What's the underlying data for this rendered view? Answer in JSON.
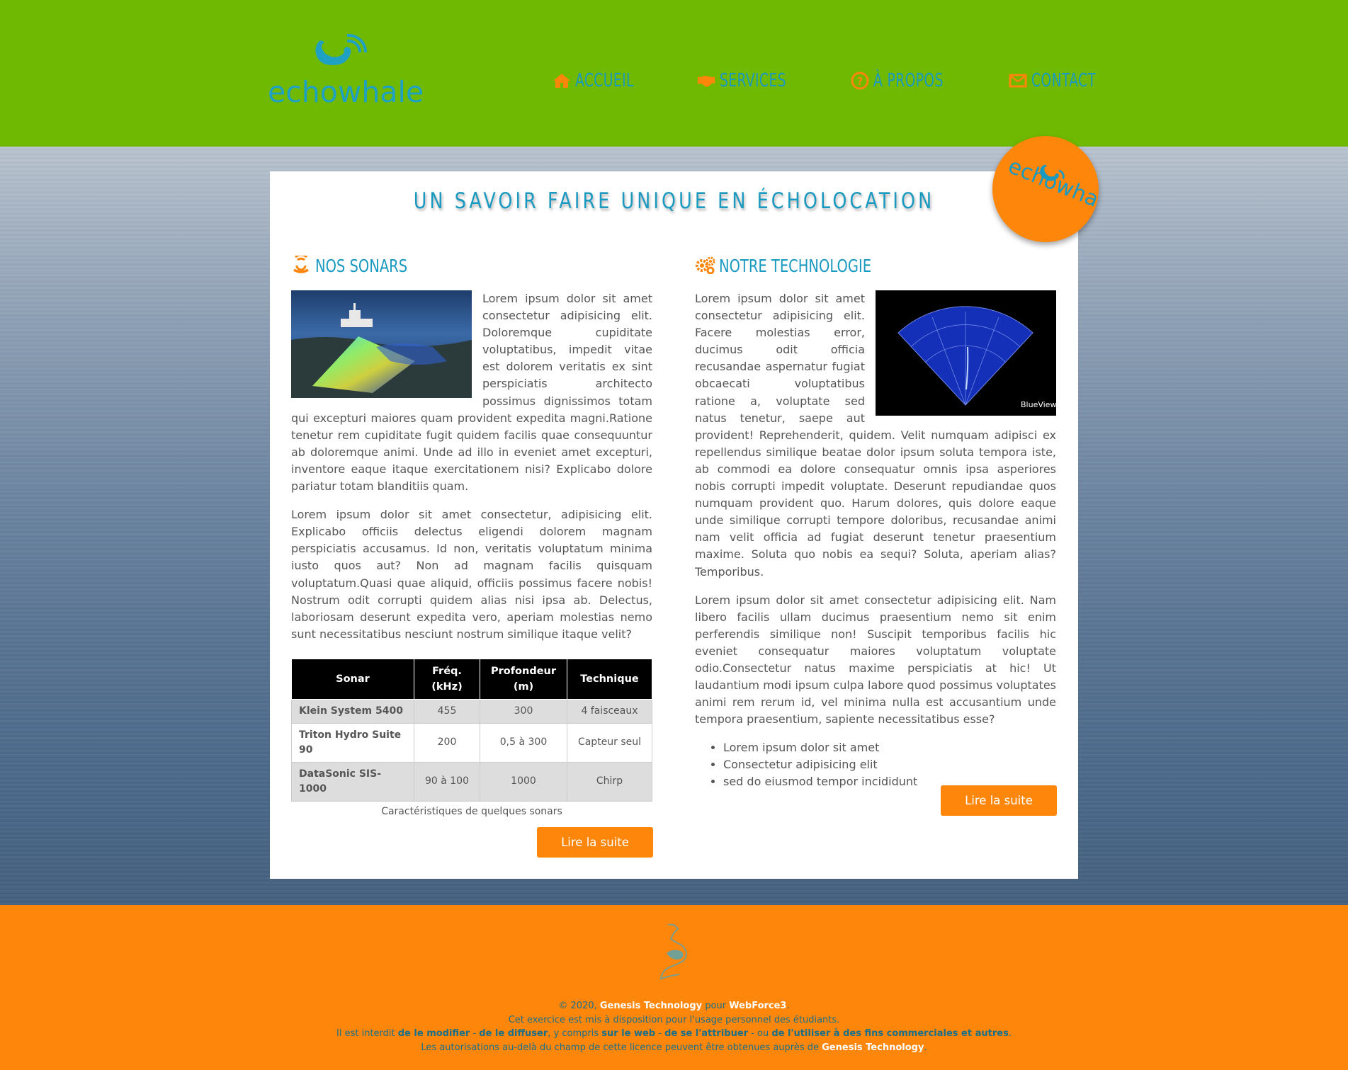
{
  "brand": {
    "logo_text_1": "echo",
    "logo_text_2": "whale",
    "badge_text": "echowhale"
  },
  "nav": [
    {
      "label": "ACCUEIL",
      "icon": "home-icon"
    },
    {
      "label": "SERVICES",
      "icon": "handshake-icon"
    },
    {
      "label": "À PROPOS",
      "icon": "question-circle-icon"
    },
    {
      "label": "CONTACT",
      "icon": "envelope-icon"
    }
  ],
  "colors": {
    "green": "#6fb902",
    "orange": "#fd860b",
    "blue": "#1a9ac0"
  },
  "main": {
    "title": "UN SAVOIR FAIRE UNIQUE EN ÉCHOLOCATION"
  },
  "left": {
    "title": "NOS SONARS",
    "p1": "Lorem ipsum dolor sit amet consectetur adipisicing elit. Doloremque cupiditate voluptatibus, impedit vitae est dolorem veritatis ex sint perspiciatis architecto possimus dignissimos totam qui excepturi maiores quam provident expedita magni.Ratione tenetur rem cupiditate fugit quidem facilis quae consequuntur ab doloremque animi. Unde ad illo in eveniet amet excepturi, inventore eaque itaque exercitationem nisi? Explicabo dolore pariatur totam blanditiis quam.",
    "p2": "Lorem ipsum dolor sit amet consectetur, adipisicing elit. Explicabo officiis delectus eligendi dolorem magnam perspiciatis accusamus. Id non, veritatis voluptatum minima iusto quos aut? Non ad magnam facilis quisquam voluptatum.Quasi quae aliquid, officiis possimus facere nobis! Nostrum odit corrupti quidem alias nisi ipsa ab. Delectus, laboriosam deserunt expedita vero, aperiam molestias nemo sunt necessitatibus nesciunt nostrum similique itaque velit?",
    "table": {
      "headers": [
        "Sonar",
        "Fréq. (kHz)",
        "Profondeur (m)",
        "Technique"
      ],
      "rows": [
        [
          "Klein System 5400",
          "455",
          "300",
          "4 faisceaux"
        ],
        [
          "Triton Hydro Suite 90",
          "200",
          "0,5 à 300",
          "Capteur seul"
        ],
        [
          "DataSonic SIS-1000",
          "90 à 100",
          "1000",
          "Chirp"
        ]
      ],
      "caption": "Caractéristiques de quelques sonars"
    },
    "button": "Lire la suite"
  },
  "right": {
    "title": "NOTRE TECHNOLOGIE",
    "p1": "Lorem ipsum dolor sit amet consectetur adipisicing elit. Facere molestias error, ducimus odit officia recusandae aspernatur fugiat obcaecati voluptatibus ratione a, voluptate sed natus tenetur, saepe aut provident! Reprehenderit, quidem. Velit numquam adipisci ex repellendus similique beatae dolor ipsum soluta tempora iste, ab commodi ea dolore consequatur omnis ipsa asperiores nobis corrupti impedit voluptate. Deserunt repudiandae quos numquam provident quo. Harum dolores, quis dolore eaque unde similique corrupti tempore doloribus, recusandae animi nam velit officia ad fugiat deserunt tenetur praesentium maxime. Soluta quo nobis ea sequi? Soluta, aperiam alias? Temporibus.",
    "p2": "Lorem ipsum dolor sit amet consectetur adipisicing elit. Nam libero facilis ullam ducimus praesentium nemo sit enim perferendis similique non! Suscipit temporibus facilis hic eveniet consequatur maiores voluptatum voluptate odio.Consectetur natus maxime perspiciatis at hic! Ut laudantium modi ipsum culpa labore quod possimus voluptates animi rem rerum id, vel minima nulla est accusantium unde tempora praesentium, sapiente necessitatibus esse?",
    "list": [
      "Lorem ipsum dolor sit amet",
      "Consectetur adipisicing elit",
      "sed do eiusmod tempor incididunt"
    ],
    "button": "Lire la suite",
    "image_label": "BlueView"
  },
  "footer": {
    "line1_a": "© 2020, ",
    "line1_b": "Genesis Technology",
    "line1_c": " pour ",
    "line1_d": "WebForce3",
    "line1_e": ".",
    "line2": "Cet exercice est mis à disposition pour l'usage personnel des étudiants.",
    "line3_a": "Il est interdit ",
    "line3_b": "de le modifier",
    "line3_c": " - ",
    "line3_d": "de le diffuser",
    "line3_e": ", y compris ",
    "line3_f": "sur le web",
    "line3_g": " - ",
    "line3_h": "de se l'attribuer",
    "line3_i": " - ou ",
    "line3_j": "de l'utiliser à des fins commerciales et autres",
    "line3_k": ".",
    "line4_a": "Les autorisations au-delà du champ de cette licence peuvent être obtenues auprès de ",
    "line4_b": "Genesis Technology",
    "line4_c": "."
  }
}
